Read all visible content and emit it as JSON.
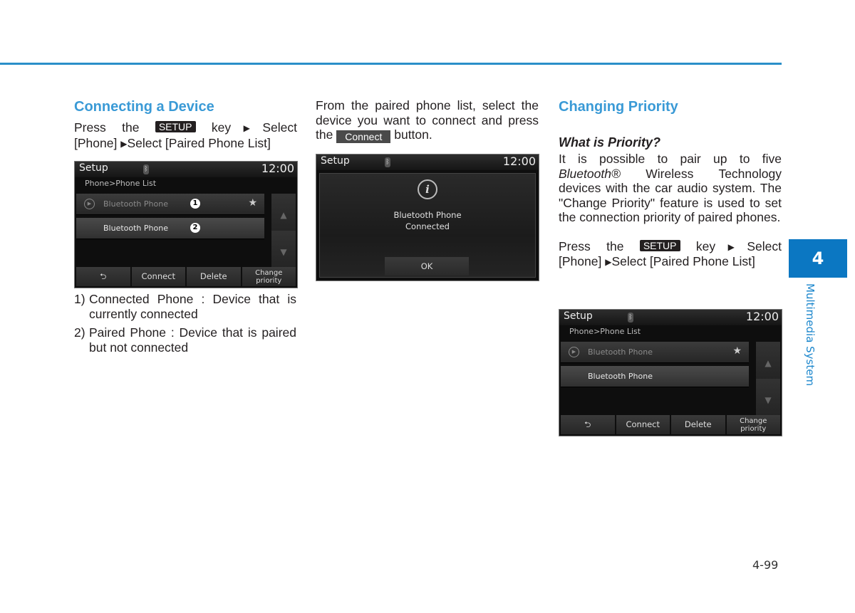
{
  "section1": {
    "title": "Connecting a Device",
    "instr_press": "Press the",
    "key_label": "SETUP",
    "instr_key": "key",
    "instr_select1": "Select",
    "instr_phone": "[Phone]",
    "instr_select2": "Select [Paired Phone List]",
    "notes": [
      {
        "num": "1)",
        "text": "Connected Phone : Device that is currently connected"
      },
      {
        "num": "2)",
        "text": "Paired Phone : Device that is paired but not connected"
      }
    ]
  },
  "section2": {
    "text_before": "From the paired phone list, select the device you want to connect and press the",
    "button_label": "Connect",
    "text_after": "button."
  },
  "section3": {
    "title": "Changing Priority",
    "subtitle": "What is Priority?",
    "para_start": "It is possible to pair up to five",
    "para_italic": "Bluetooth®",
    "para_rest": "Wireless Technology devices with the car audio system. The \"Change Priority\" feature is used to set the connection priority of paired phones.",
    "instr_press": "Press the",
    "key_label": "SETUP",
    "instr_key": "key",
    "instr_select1": "Select",
    "instr_phone": "[Phone]",
    "instr_select2": "Select [Paired Phone List]"
  },
  "screen_list": {
    "title": "Setup",
    "time": "12:00",
    "breadcrumb": "Phone>Phone List",
    "rows": [
      {
        "label": "Bluetooth Phone",
        "callout": "1",
        "starred": true,
        "connected": true
      },
      {
        "label": "Bluetooth Phone",
        "callout": "2",
        "starred": false,
        "connected": false
      }
    ],
    "footer": {
      "back": "⮌",
      "connect": "Connect",
      "delete": "Delete",
      "priority": "Change priority"
    }
  },
  "screen_popup": {
    "title": "Setup",
    "time": "12:00",
    "message_line1": "Bluetooth Phone",
    "message_line2": "Connected",
    "ok": "OK"
  },
  "chapter": {
    "number": "4",
    "label": "Multimedia System"
  },
  "page_number": "4-99",
  "colors": {
    "accent": "#3a9ad6",
    "tab": "#0b77c2",
    "rule": "#2a8fc9"
  }
}
